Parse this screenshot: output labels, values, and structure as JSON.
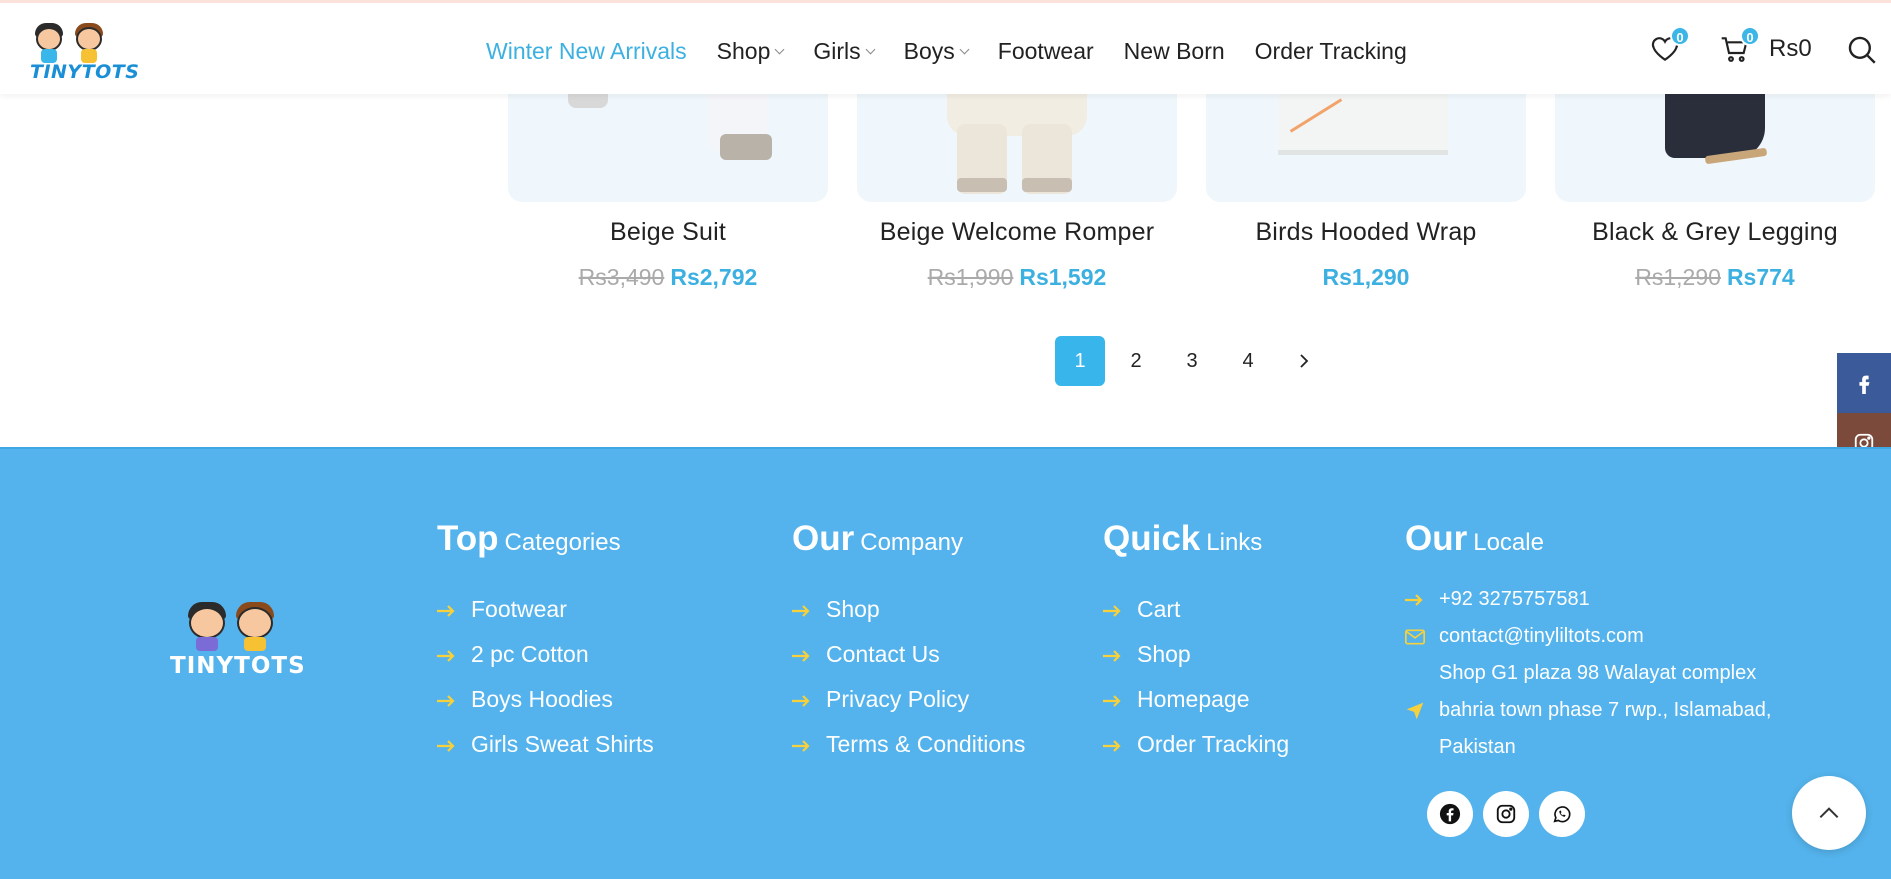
{
  "brand": {
    "name": "TINYTOTS"
  },
  "nav": {
    "items": [
      {
        "label": "Winter New Arrivals",
        "active": true,
        "dropdown": false
      },
      {
        "label": "Shop",
        "active": false,
        "dropdown": true
      },
      {
        "label": "Girls",
        "active": false,
        "dropdown": true
      },
      {
        "label": "Boys",
        "active": false,
        "dropdown": true
      },
      {
        "label": "Footwear",
        "active": false,
        "dropdown": false
      },
      {
        "label": "New Born",
        "active": false,
        "dropdown": false
      },
      {
        "label": "Order Tracking",
        "active": false,
        "dropdown": false
      }
    ]
  },
  "header_icons": {
    "wishlist_count": "0",
    "cart_count": "0",
    "cart_total": "Rs0"
  },
  "products": [
    {
      "name": "Beige Suit",
      "old_price": "Rs3,490",
      "new_currency": "Rs",
      "new_price": "2,792"
    },
    {
      "name": "Beige Welcome Romper",
      "old_price": "Rs1,990",
      "new_currency": "Rs",
      "new_price": "1,592"
    },
    {
      "name": "Birds Hooded Wrap",
      "old_price": "",
      "new_currency": "Rs",
      "new_price": "1,290"
    },
    {
      "name": "Black & Grey Legging",
      "old_price": "Rs1,290",
      "new_currency": "Rs",
      "new_price": "774"
    }
  ],
  "pagination": {
    "pages": [
      "1",
      "2",
      "3",
      "4"
    ],
    "current": "1"
  },
  "footer": {
    "logo_text": "TINYTOTS",
    "columns": [
      {
        "head_big": "Top",
        "head_small": "Categories",
        "links": [
          "Footwear",
          "2 pc Cotton",
          "Boys Hoodies",
          "Girls Sweat Shirts"
        ]
      },
      {
        "head_big": "Our",
        "head_small": "Company",
        "links": [
          "Shop",
          "Contact Us",
          "Privacy Policy",
          "Terms & Conditions"
        ]
      },
      {
        "head_big": "Quick",
        "head_small": "Links",
        "links": [
          "Cart",
          "Shop",
          "Homepage",
          "Order Tracking"
        ]
      }
    ],
    "locale": {
      "head_big": "Our",
      "head_small": "Locale",
      "phone": "+92 3275757581",
      "email": "contact@tinyliltots.com",
      "address_line1": "Shop G1 plaza 98 Walayat complex",
      "address_line2": "bahria town phase 7 rwp., Islamabad,",
      "address_line3": "Pakistan"
    }
  },
  "colors": {
    "accent": "#3cb0e0",
    "footer_bg": "#54b3ec",
    "arrow_yellow": "#f6d13b",
    "facebook": "#3b5a9a",
    "instagram": "#7b4a3a",
    "whatsapp": "#27c199"
  }
}
